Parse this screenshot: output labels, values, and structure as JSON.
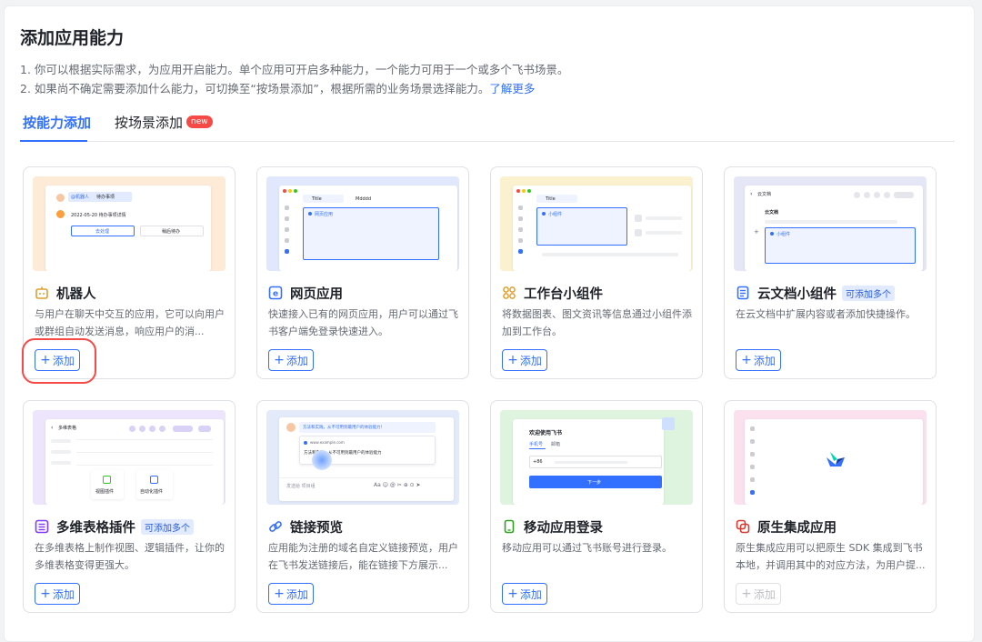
{
  "page": {
    "title": "添加应用能力",
    "desc1": "1. 你可以根据实际需求，为应用开启能力。单个应用可开启多种能力，一个能力可用于一个或多个飞书场景。",
    "desc2_prefix": "2. 如果尚不确定需要添加什么能力，可切换至“按场景添加”，根据所需的业务场景选择能力。",
    "learn_more": "了解更多"
  },
  "tabs": [
    {
      "label": "按能力添加",
      "active": true
    },
    {
      "label": "按场景添加",
      "active": false,
      "badge": "new"
    }
  ],
  "add_label": "添加",
  "cards": [
    {
      "title": "机器人",
      "desc": "与用户在聊天中交互的应用，它可以向用户或群组自动发送消息，响应用户的消...",
      "icon": "robot-icon",
      "color": "#fdebd8",
      "preview": {
        "chip": "@机器人",
        "chip_text": "待办事项",
        "date": "2022-05-20 待办事项详情",
        "btn1": "去处理",
        "btn2": "稍后待办"
      }
    },
    {
      "title": "网页应用",
      "desc": "快速接入已有的网页应用，用户可以通过飞书客户端免登录快速进入。",
      "icon": "web-app-icon",
      "color": "#e1e8fd",
      "preview": {
        "tab1": "Title",
        "tab2": "Mdddd",
        "box": "网页应用"
      }
    },
    {
      "title": "工作台小组件",
      "desc": "将数据图表、图文资讯等信息通过小组件添加到工作台。",
      "icon": "widget-icon",
      "color": "#fbf1cf",
      "preview": {
        "tab1": "Title",
        "box": "小组件"
      }
    },
    {
      "title": "云文档小组件",
      "desc": "在云文档中扩展内容或者添加快捷操作。",
      "icon": "doc-icon",
      "tag": "可添加多个",
      "color": "#e5e7f7",
      "preview": {
        "header": "云文档",
        "label": "云文档",
        "box": "小组件"
      }
    },
    {
      "title": "多维表格插件",
      "desc": "在多维表格上制作视图、逻辑插件，让你的多维表格变得更强大。",
      "icon": "bitable-icon",
      "tag": "可添加多个",
      "color": "#ece5fb",
      "preview": {
        "header": "多维表格",
        "btn1": "视图插件",
        "btn2": "自动化插件"
      }
    },
    {
      "title": "链接预览",
      "desc": "应用能为注册的域名自定义链接预览，用户在飞书发送链接后，能在链接下方展示...",
      "icon": "link-icon",
      "color": "#e3ebfa",
      "preview": {
        "msg": "方法和实践，从不可用到最用户的体验能力！",
        "domain": "www.example.com",
        "sub": "方法和实践，从不可用到最用户的体验能力",
        "input": "发送给 项目组"
      }
    },
    {
      "title": "移动应用登录",
      "desc": "移动应用可以通过飞书账号进行登录。",
      "icon": "mobile-icon",
      "color": "#dff4df",
      "preview": {
        "welcome": "欢迎使用飞书",
        "tab1": "手机号",
        "tab2": "邮箱",
        "code": "+86",
        "btn": "下一步"
      }
    },
    {
      "title": "原生集成应用",
      "desc": "原生集成应用可以把原生 SDK 集成到飞书本地，并调用其中的对应方法，为用户提...",
      "icon": "native-app-icon",
      "color": "#fbe1ee",
      "disabled": true,
      "preview": {}
    }
  ]
}
